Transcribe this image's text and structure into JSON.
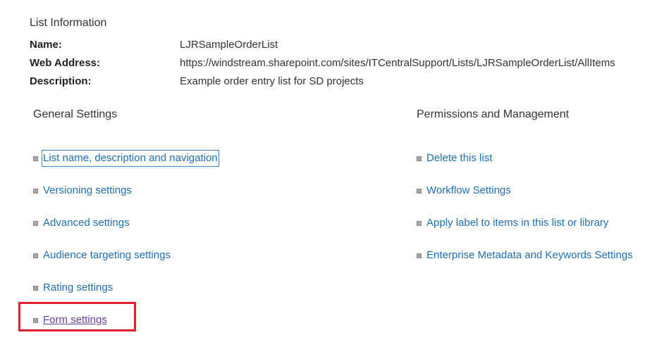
{
  "list_information": {
    "title": "List Information",
    "name_label": "Name:",
    "name_value": "LJRSampleOrderList",
    "web_address_label": "Web Address:",
    "web_address_value": "https://windstream.sharepoint.com/sites/ITCentralSupport/Lists/LJRSampleOrderList/AllItems",
    "description_label": "Description:",
    "description_value": "Example order entry list for SD projects"
  },
  "general_settings": {
    "title": "General Settings",
    "items": [
      {
        "label": "List name, description and navigation"
      },
      {
        "label": "Versioning settings"
      },
      {
        "label": "Advanced settings"
      },
      {
        "label": "Audience targeting settings"
      },
      {
        "label": "Rating settings"
      },
      {
        "label": "Form settings"
      }
    ]
  },
  "permissions_management": {
    "title": "Permissions and Management",
    "items": [
      {
        "label": "Delete this list"
      },
      {
        "label": "Workflow Settings"
      },
      {
        "label": "Apply label to items in this list or library"
      },
      {
        "label": "Enterprise Metadata and Keywords Settings"
      }
    ]
  },
  "colors": {
    "link": "#1f6fb5",
    "visited_link": "#6b3fa0",
    "highlight": "#e0202a"
  }
}
